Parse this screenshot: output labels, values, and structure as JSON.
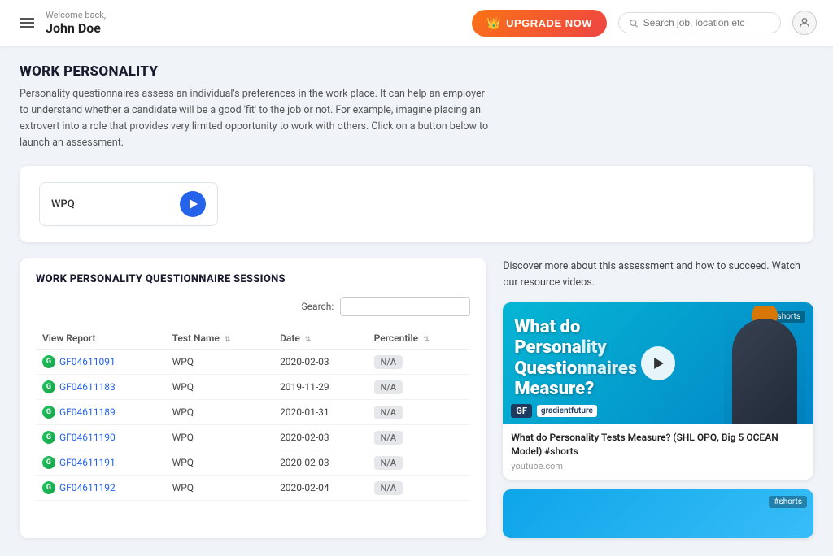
{
  "header": {
    "welcome": "Welcome back,",
    "username": "John Doe",
    "upgrade_label": "UPGRADE NOW",
    "search_placeholder": "Search job, location etc",
    "hamburger_label": "menu"
  },
  "page": {
    "section_title": "WORK PERSONALITY",
    "section_desc": "Personality questionnaires assess an individual's preferences in the work place. It can help an employer to understand whether a candidate will be a good 'fit' to the job or not. For example, imagine placing an extrovert into a role that provides very limited opportunity to work with others. Click on a button below to launch an assessment.",
    "wpq_label": "WPQ"
  },
  "sessions": {
    "title": "WORK PERSONALITY QUESTIONNAIRE SESSIONS",
    "search_label": "Search:",
    "search_value": "",
    "columns": [
      {
        "label": "View Report",
        "sortable": false
      },
      {
        "label": "Test Name",
        "sortable": true
      },
      {
        "label": "Date",
        "sortable": true
      },
      {
        "label": "Percentile",
        "sortable": true
      }
    ],
    "rows": [
      {
        "id": "GF04611091",
        "test": "WPQ",
        "date": "2020-02-03",
        "percentile": "N/A"
      },
      {
        "id": "GF04611183",
        "test": "WPQ",
        "date": "2019-11-29",
        "percentile": "N/A"
      },
      {
        "id": "GF04611189",
        "test": "WPQ",
        "date": "2020-01-31",
        "percentile": "N/A"
      },
      {
        "id": "GF04611190",
        "test": "WPQ",
        "date": "2020-02-03",
        "percentile": "N/A"
      },
      {
        "id": "GF04611191",
        "test": "WPQ",
        "date": "2020-02-03",
        "percentile": "N/A"
      },
      {
        "id": "GF04611192",
        "test": "WPQ",
        "date": "2020-02-04",
        "percentile": "N/A"
      }
    ]
  },
  "video_panel": {
    "description": "Discover more about this assessment and how to succeed. Watch our resource videos.",
    "video1": {
      "tag": "#shorts",
      "title_line1": "What do",
      "title_line2": "Personality",
      "title_line3": "Questionnaires",
      "title_line4": "Measure?",
      "video_title": "What do Personality Tests Measure? (SHL OPQ, Big 5 OCEAN Model) #shorts",
      "source": "youtube.com"
    }
  }
}
